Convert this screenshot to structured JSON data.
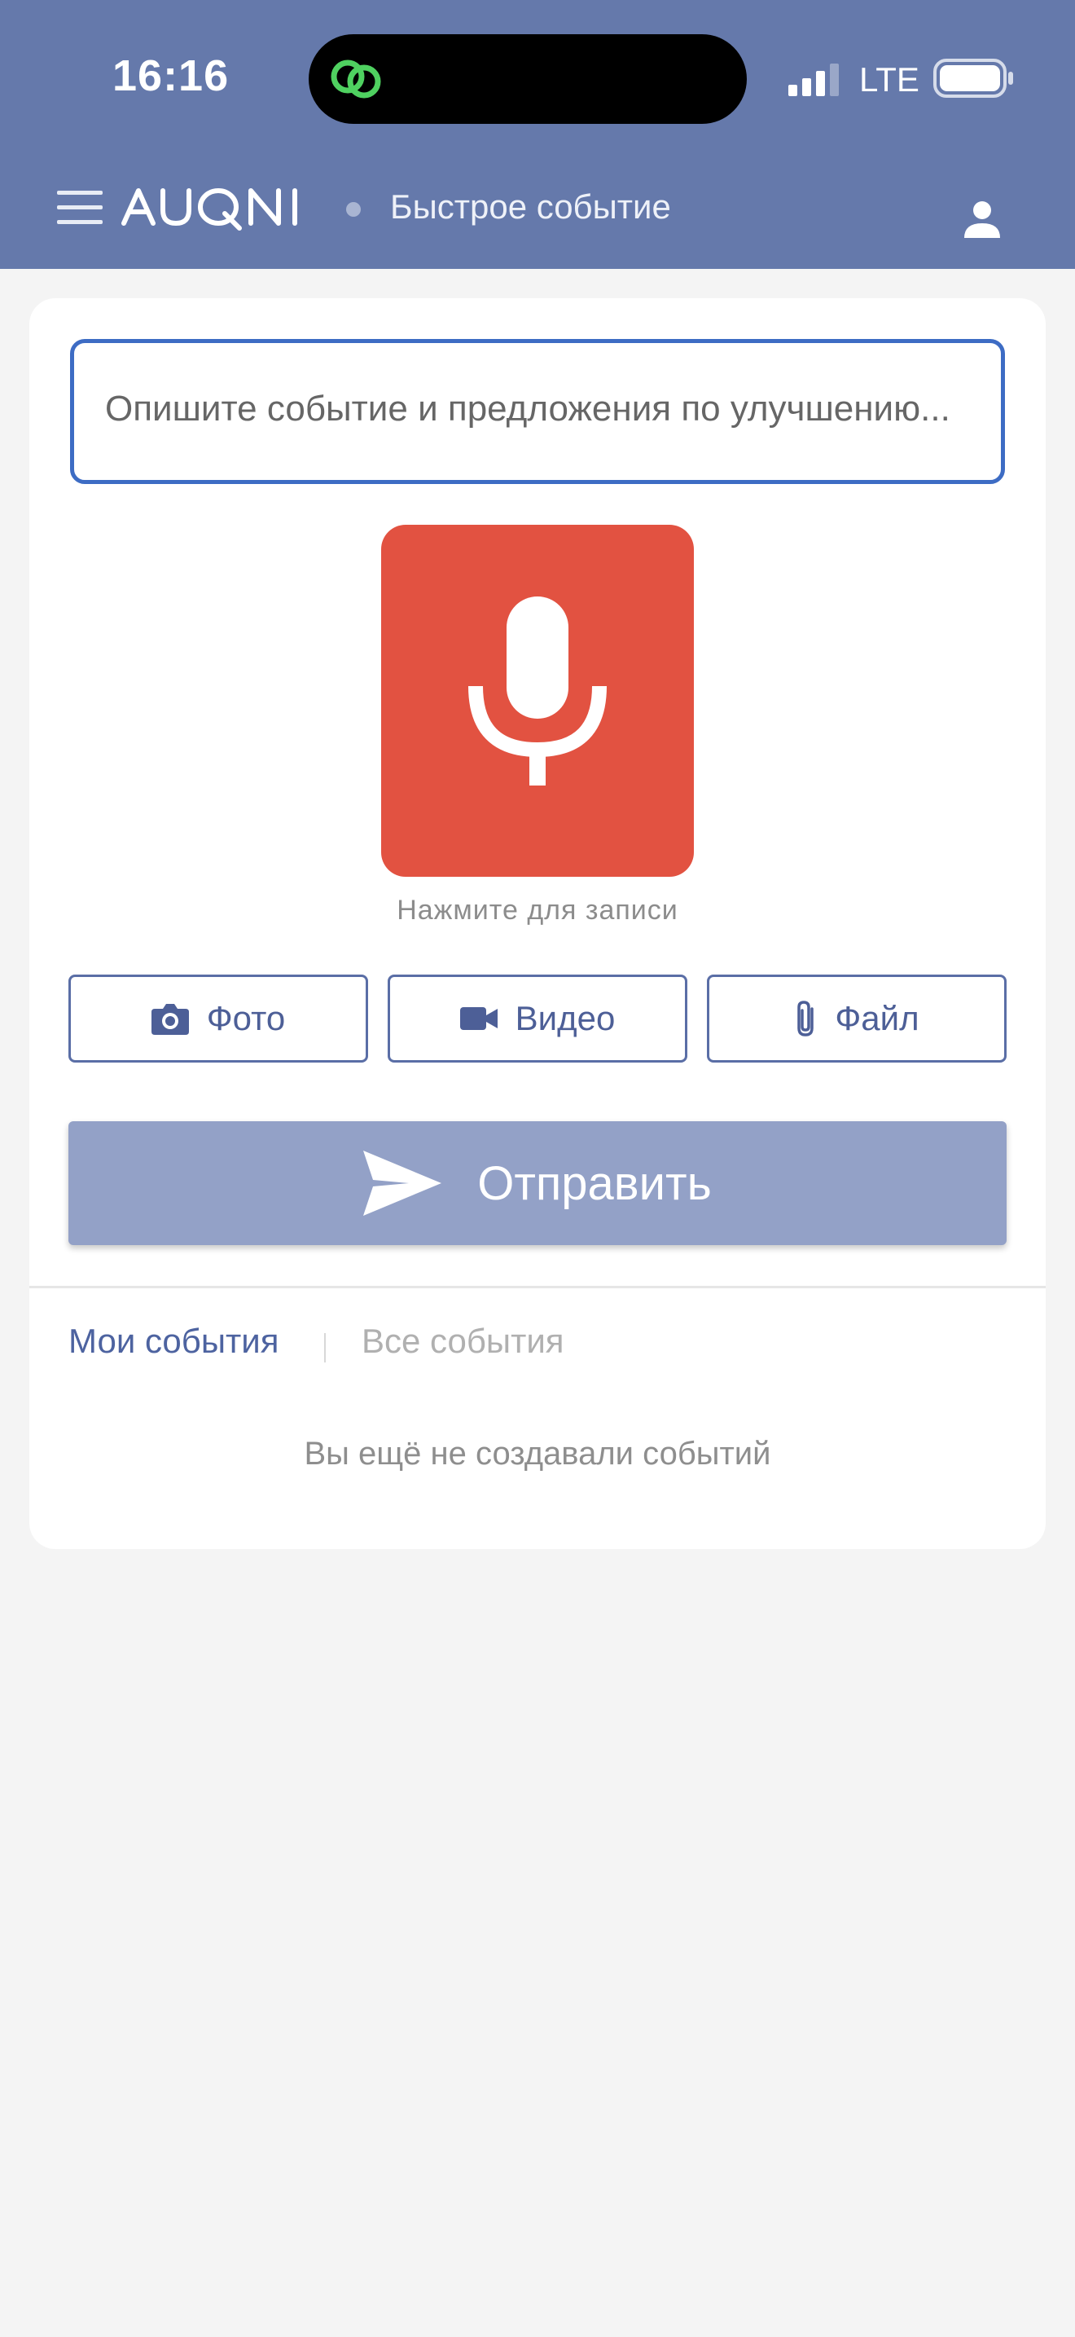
{
  "status_bar": {
    "time": "16:16",
    "network": "LTE"
  },
  "header": {
    "logo_text": "AUQNI",
    "title": "Быстрое событие",
    "icons": {
      "menu": "hamburger-icon",
      "user": "user-icon"
    }
  },
  "form": {
    "description_placeholder": "Опишите событие и предложения по улучшению...",
    "description_value": "",
    "mic_hint": "Нажмите для записи",
    "buttons": {
      "photo": "Фото",
      "video": "Видео",
      "file": "Файл",
      "send": "Отправить"
    }
  },
  "events": {
    "tabs": [
      {
        "label": "Мои события",
        "active": true
      },
      {
        "label": "Все события",
        "active": false
      }
    ],
    "empty_message": "Вы ещё не создавали событий"
  },
  "colors": {
    "header_bg": "#6579ab",
    "mic_red": "#e25241",
    "send_disabled": "#93a1c7",
    "accent": "#4d5f97"
  }
}
